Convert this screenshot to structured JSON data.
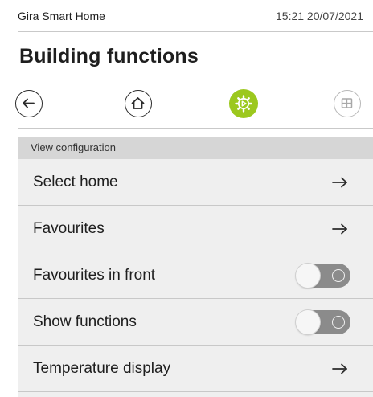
{
  "status": {
    "app_name": "Gira Smart Home",
    "clock": "15:21 20/07/2021"
  },
  "header": {
    "title": "Building functions"
  },
  "nav": [
    {
      "icon": "back-arrow-icon",
      "state": "normal"
    },
    {
      "icon": "home-icon",
      "state": "normal"
    },
    {
      "icon": "settings-gear-icon",
      "state": "active"
    },
    {
      "icon": "grid-icon",
      "state": "disabled"
    }
  ],
  "colors": {
    "accent": "#9cc81e",
    "toggle_off": "#8b8b8b",
    "list_bg": "#efefef",
    "section_bg": "#d6d6d6"
  },
  "section": {
    "title": "View configuration"
  },
  "items": [
    {
      "label": "Select home",
      "control": "arrow"
    },
    {
      "label": "Favourites",
      "control": "arrow"
    },
    {
      "label": "Favourites in front",
      "control": "toggle",
      "toggle_on": false
    },
    {
      "label": "Show functions",
      "control": "toggle",
      "toggle_on": false
    },
    {
      "label": "Temperature display",
      "control": "arrow"
    }
  ]
}
